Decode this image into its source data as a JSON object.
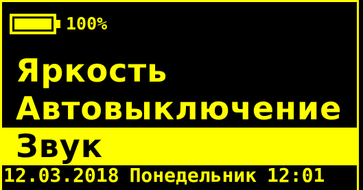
{
  "status": {
    "battery_icon": "battery-full-icon",
    "battery_level": 100,
    "battery_text": "100%"
  },
  "menu": {
    "items": [
      {
        "label": "Яркость",
        "selected": false
      },
      {
        "label": "Автовыключение",
        "selected": false
      },
      {
        "label": "Звук",
        "selected": true
      }
    ]
  },
  "footer": {
    "date": "12.03.2018",
    "weekday": "Понедельник",
    "time": "12:01"
  },
  "colors": {
    "background": "#000000",
    "accent": "#ffff00",
    "selected_text": "#000000"
  }
}
